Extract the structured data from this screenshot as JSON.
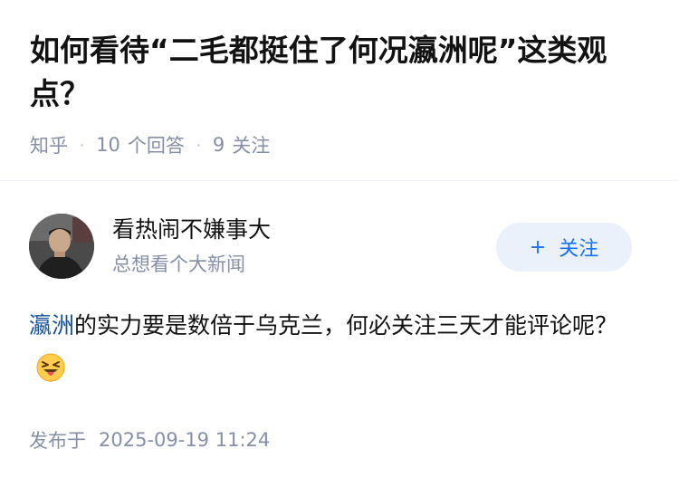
{
  "question": {
    "title": "如何看待“二毛都挺住了何况瀛洲呢”这类观点？",
    "source": "知乎",
    "answer_count": "10",
    "answer_label": "个回答",
    "follower_count": "9",
    "follower_label": "关注"
  },
  "author": {
    "name": "看热闹不嫌事大",
    "bio": "总想看个大新闻",
    "avatar_icon": "person-avatar",
    "follow_label": "关注",
    "follow_icon": "plus-icon"
  },
  "answer": {
    "link_text": "瀛洲",
    "text": "的实力要是数倍于乌克兰，何必关注三天才能评论呢？",
    "emoji": "squinting-tongue-emoji"
  },
  "footer": {
    "published_label": "发布于",
    "published_time": "2025-09-19 11:24"
  },
  "colors": {
    "accent": "#1772f6",
    "link": "#175199",
    "meta": "#8590a6",
    "follow_bg": "#eaf1fb"
  }
}
